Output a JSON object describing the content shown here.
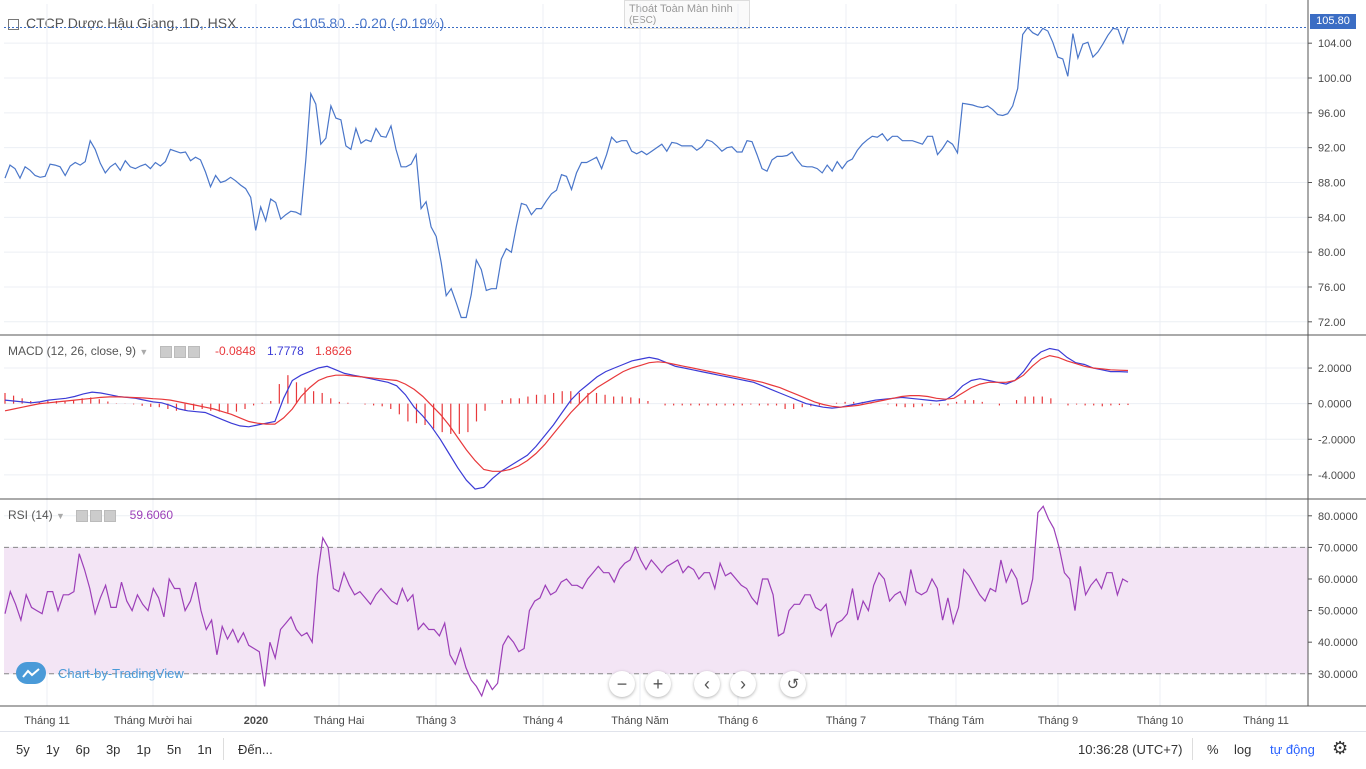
{
  "header": {
    "title": "CTCP Dược Hậu Giang, 1D, HSX",
    "price_prefix": "C",
    "close": "105.80",
    "change": "-0.20 (-0.19%)",
    "fullscreen_hint": "Thoát Toàn Màn hình",
    "fullscreen_key": "(ESC)",
    "last_price_tag": "105.80"
  },
  "macd_legend": {
    "label": "MACD (12, 26, close, 9)",
    "hist": "-0.0848",
    "macd": "1.7778",
    "signal": "1.8626"
  },
  "rsi_legend": {
    "label": "RSI (14)",
    "value": "59.6060"
  },
  "watermark": "Chart-by-TradingView",
  "toolbar": {
    "ranges": [
      "5y",
      "1y",
      "6p",
      "3p",
      "1p",
      "5n",
      "1n"
    ],
    "goto": "Đến...",
    "time": "10:36:28 (UTC+7)",
    "percent": "%",
    "log": "log",
    "auto": "tự động"
  },
  "colors": {
    "price": "#4a76c9",
    "macd": "#3b3bd6",
    "signal": "#e8383b",
    "rsi": "#9c3fb8",
    "rsi_band": "#f3e5f5"
  },
  "chart_data": [
    {
      "type": "line",
      "title": "CTCP Dược Hậu Giang, 1D, HSX",
      "x_ticks": [
        "Tháng 11",
        "Tháng Mười hai",
        "2020",
        "Tháng Hai",
        "Tháng 3",
        "Tháng 4",
        "Tháng Năm",
        "Tháng 6",
        "Tháng 7",
        "Tháng Tám",
        "Tháng 9",
        "Tháng 10",
        "Tháng 11"
      ],
      "y_ticks": [
        "72.00",
        "76.00",
        "80.00",
        "84.00",
        "88.00",
        "92.00",
        "96.00",
        "100.00",
        "104.00"
      ],
      "ylim": [
        70.6,
        108.5
      ],
      "series": [
        {
          "values": [
            88.5,
            90,
            89.6,
            88.5,
            89.8,
            89.4,
            88.8,
            88.6,
            88.7,
            90.1,
            90,
            89.8,
            88.8,
            89.9,
            90.3,
            90,
            90.4,
            92.8,
            91.8,
            90.2,
            89.1,
            89.8,
            90.2,
            89.4,
            90.5,
            89.8,
            89.6,
            89.9,
            90.1,
            89.6,
            90.3,
            89.9,
            90.4,
            91.8,
            91.6,
            91.4,
            91.5,
            90.5,
            90.9,
            90.6,
            89.2,
            87.5,
            88.8,
            88,
            88.2,
            88.6,
            88.2,
            87.7,
            87.3,
            86.3,
            82.5,
            85.2,
            83.6,
            86.1,
            85.7,
            83.8,
            84.3,
            84.7,
            84.6,
            84.3,
            90.6,
            98.2,
            97,
            92.4,
            93.1,
            96.8,
            95.4,
            95.2,
            92.2,
            91.8,
            94.2,
            92.5,
            92.9,
            92.7,
            94.2,
            93.3,
            93.2,
            94.5,
            91.8,
            89.8,
            89.8,
            90.1,
            91.2,
            85,
            85.8,
            82.9,
            81.8,
            78.8,
            75,
            75.8,
            74.2,
            72.5,
            72.5,
            75.1,
            79.1,
            78,
            75.6,
            75.8,
            75.8,
            79.2,
            80.4,
            80,
            83,
            85.6,
            85.4,
            84.3,
            85,
            85,
            85.9,
            86.7,
            87.1,
            88.9,
            88.7,
            87.2,
            89.1,
            90.3,
            90.3,
            90.6,
            90.9,
            89.6,
            91.2,
            93.2,
            92.6,
            92.8,
            92.8,
            91.6,
            91.3,
            91.6,
            91.2,
            91.6,
            92,
            92.4,
            91.6,
            92.6,
            92.5,
            92.2,
            92.2,
            92.2,
            91.7,
            92.1,
            92.9,
            92.7,
            92.2,
            91.6,
            92,
            92.1,
            91.5,
            91.5,
            92.8,
            92.7,
            91.2,
            89.6,
            89.3,
            90.6,
            91,
            91,
            91.1,
            91.5,
            90.6,
            89.9,
            89.8,
            89.8,
            89.6,
            89.1,
            90,
            89.3,
            90.4,
            89.6,
            90.4,
            90.7,
            91.7,
            92.4,
            92.9,
            93.3,
            93.2,
            93.6,
            92.8,
            93.3,
            93.3,
            92.8,
            92.8,
            92.8,
            92.6,
            92.4,
            93.3,
            93.3,
            91.2,
            91.9,
            92.8,
            92.4,
            91.4,
            97.1,
            97,
            96.9,
            96.7,
            96.6,
            96.8,
            96.4,
            95.8,
            95.7,
            95.9,
            96.8,
            98.8,
            105,
            105.8,
            105.2,
            104.9,
            105.7,
            105.4,
            104.1,
            102.4,
            102.2,
            100.2,
            105.1,
            102.3,
            103.9,
            104.1,
            102.4,
            103,
            103.9,
            104.9,
            105.7,
            105.6,
            104,
            105.8
          ]
        }
      ]
    },
    {
      "type": "line",
      "title": "MACD (12, 26, close, 9)",
      "y_ticks": [
        "2.0000",
        "0.0000",
        "-2.0000",
        "-4.0000"
      ],
      "ylim": [
        -5.3,
        3.8
      ],
      "series": [
        {
          "name": "MACD",
          "values": [
            0.2,
            0.15,
            0.1,
            0.05,
            0.1,
            0.2,
            0.25,
            0.3,
            0.4,
            0.55,
            0.65,
            0.6,
            0.5,
            0.4,
            0.35,
            0.3,
            0.2,
            0.1,
            0.05,
            -0.1,
            -0.3,
            -0.4,
            -0.45,
            -0.5,
            -0.7,
            -0.9,
            -1.1,
            -1.25,
            -1.3,
            -1.2,
            -1.1,
            -1.0,
            0.3,
            1.3,
            1.6,
            1.8,
            2.0,
            2.1,
            1.9,
            1.7,
            1.6,
            1.5,
            1.4,
            1.3,
            1.2,
            1.0,
            0.5,
            -0.2,
            -0.7,
            -1.3,
            -2.0,
            -2.8,
            -3.6,
            -4.3,
            -4.8,
            -4.7,
            -4.2,
            -3.8,
            -3.5,
            -3.2,
            -2.9,
            -2.4,
            -1.8,
            -1.2,
            -0.5,
            0.2,
            0.7,
            1.1,
            1.5,
            1.8,
            2.0,
            2.2,
            2.4,
            2.5,
            2.6,
            2.5,
            2.3,
            2.1,
            2.0,
            1.9,
            1.8,
            1.7,
            1.6,
            1.5,
            1.4,
            1.3,
            1.2,
            1.0,
            0.8,
            0.6,
            0.4,
            0.2,
            0.0,
            -0.1,
            -0.2,
            -0.25,
            -0.2,
            -0.1,
            0.0,
            0.1,
            0.2,
            0.25,
            0.3,
            0.35,
            0.3,
            0.25,
            0.2,
            0.15,
            0.2,
            0.5,
            1.0,
            1.3,
            1.4,
            1.3,
            1.2,
            1.1,
            1.3,
            1.8,
            2.5,
            2.9,
            3.1,
            3.0,
            2.6,
            2.3,
            2.2,
            2.0,
            1.9,
            1.8,
            1.8,
            1.78
          ]
        },
        {
          "name": "Signal",
          "values": [
            -0.4,
            -0.3,
            -0.2,
            -0.1,
            0.0,
            0.05,
            0.1,
            0.15,
            0.2,
            0.25,
            0.3,
            0.35,
            0.38,
            0.38,
            0.36,
            0.34,
            0.32,
            0.28,
            0.25,
            0.2,
            0.1,
            0.0,
            -0.1,
            -0.2,
            -0.3,
            -0.45,
            -0.6,
            -0.8,
            -1.0,
            -1.1,
            -1.15,
            -1.15,
            -0.8,
            -0.3,
            0.4,
            0.9,
            1.3,
            1.5,
            1.6,
            1.6,
            1.55,
            1.5,
            1.45,
            1.4,
            1.35,
            1.3,
            1.1,
            0.8,
            0.4,
            -0.1,
            -0.6,
            -1.2,
            -1.9,
            -2.6,
            -3.2,
            -3.7,
            -3.8,
            -3.8,
            -3.7,
            -3.5,
            -3.2,
            -2.8,
            -2.3,
            -1.7,
            -1.1,
            -0.5,
            0.0,
            0.5,
            0.9,
            1.2,
            1.5,
            1.8,
            2.0,
            2.15,
            2.3,
            2.35,
            2.3,
            2.2,
            2.1,
            2.0,
            1.9,
            1.8,
            1.7,
            1.6,
            1.5,
            1.4,
            1.3,
            1.2,
            1.05,
            0.9,
            0.7,
            0.5,
            0.3,
            0.1,
            -0.05,
            -0.15,
            -0.2,
            -0.15,
            -0.1,
            0.0,
            0.1,
            0.2,
            0.3,
            0.4,
            0.45,
            0.45,
            0.4,
            0.3,
            0.25,
            0.3,
            0.6,
            0.9,
            1.1,
            1.2,
            1.2,
            1.2,
            1.3,
            1.6,
            2.1,
            2.5,
            2.7,
            2.6,
            2.4,
            2.25,
            2.1,
            2.0,
            1.95,
            1.9,
            1.88,
            1.86
          ]
        },
        {
          "name": "Histogram",
          "values": [
            0.6,
            0.45,
            0.3,
            0.15,
            0.1,
            0.15,
            0.15,
            0.15,
            0.2,
            0.3,
            0.35,
            0.25,
            0.12,
            0.02,
            -0.01,
            -0.04,
            -0.12,
            -0.18,
            -0.2,
            -0.3,
            -0.4,
            -0.4,
            -0.35,
            -0.3,
            -0.4,
            -0.45,
            -0.5,
            -0.45,
            -0.3,
            -0.1,
            0.05,
            0.15,
            1.1,
            1.6,
            1.2,
            0.9,
            0.7,
            0.6,
            0.3,
            0.1,
            0.05,
            0.0,
            -0.05,
            -0.1,
            -0.15,
            -0.3,
            -0.6,
            -1.0,
            -1.1,
            -1.2,
            -1.4,
            -1.6,
            -1.7,
            -1.7,
            -1.6,
            -1.0,
            -0.4,
            0.0,
            0.2,
            0.3,
            0.3,
            0.4,
            0.5,
            0.5,
            0.6,
            0.7,
            0.7,
            0.6,
            0.6,
            0.6,
            0.5,
            0.4,
            0.4,
            0.35,
            0.3,
            0.15,
            0.0,
            -0.1,
            -0.1,
            -0.1,
            -0.1,
            -0.1,
            -0.1,
            -0.1,
            -0.1,
            -0.1,
            -0.1,
            -0.05,
            -0.1,
            -0.1,
            -0.1,
            -0.3,
            -0.3,
            -0.2,
            -0.15,
            -0.1,
            0.0,
            0.05,
            0.1,
            0.1,
            0.1,
            0.05,
            0.0,
            -0.05,
            -0.15,
            -0.2,
            -0.2,
            -0.15,
            -0.05,
            -0.1,
            -0.1,
            0.1,
            0.2,
            0.2,
            0.1,
            0.0,
            -0.1,
            0.0,
            0.2,
            0.4,
            0.4,
            0.4,
            0.3,
            0.0,
            -0.1,
            -0.05,
            -0.1,
            -0.1,
            -0.15,
            -0.1,
            -0.08,
            -0.08
          ]
        }
      ]
    },
    {
      "type": "line",
      "title": "RSI (14)",
      "y_ticks": [
        "80.0000",
        "70.0000",
        "60.0000",
        "50.0000",
        "40.0000",
        "30.0000"
      ],
      "ylim": [
        19.8,
        85.0
      ],
      "bands": [
        30,
        70
      ],
      "series": [
        {
          "values": [
            49,
            56,
            52,
            47,
            55,
            51,
            50,
            49,
            56,
            56,
            50,
            55,
            55,
            56,
            68,
            63,
            57,
            49,
            54,
            58,
            51,
            51,
            59,
            53,
            50,
            55,
            52,
            50,
            57,
            54,
            48,
            60,
            57,
            57,
            50,
            53,
            59,
            50,
            44,
            47,
            36,
            45,
            41,
            44,
            40,
            43,
            39,
            38,
            37,
            26,
            40,
            35,
            44,
            46,
            48,
            44,
            42,
            43,
            40,
            61,
            73,
            70,
            57,
            56,
            62,
            58,
            55,
            56,
            54,
            52,
            55,
            57,
            55,
            53,
            52,
            57,
            53,
            55,
            44,
            46,
            44,
            44,
            42,
            46,
            36,
            33,
            38,
            32,
            28,
            26,
            23,
            28,
            25,
            27,
            39,
            42,
            40,
            37,
            38,
            50,
            53,
            54,
            58,
            55,
            56,
            59,
            60,
            58,
            58,
            57,
            60,
            62,
            64,
            62,
            62,
            59,
            63,
            65,
            66,
            70,
            66,
            63,
            66,
            64,
            62,
            64,
            65,
            66,
            62,
            64,
            63,
            60,
            62,
            62,
            57,
            65,
            61,
            62,
            60,
            58,
            57,
            54,
            52,
            60,
            60,
            55,
            42,
            43,
            50,
            52,
            52,
            55,
            55,
            51,
            50,
            52,
            42,
            46,
            47,
            49,
            57,
            47,
            53,
            50,
            58,
            62,
            60,
            53,
            55,
            56,
            52,
            63,
            56,
            55,
            56,
            60,
            57,
            47,
            54,
            46,
            51,
            63,
            61,
            58,
            55,
            53,
            57,
            56,
            66,
            59,
            63,
            60,
            52,
            53,
            60,
            81,
            83,
            79,
            76,
            70,
            62,
            60,
            50,
            64,
            55,
            58,
            60,
            57,
            62,
            62,
            55,
            60,
            59
          ]
        }
      ]
    }
  ]
}
